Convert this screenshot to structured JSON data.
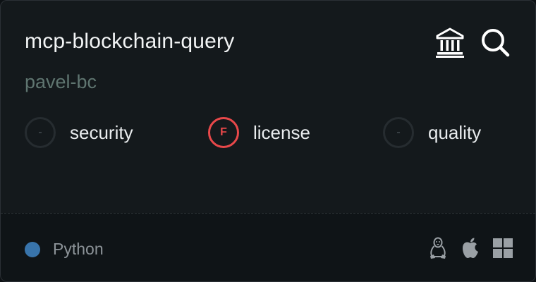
{
  "card": {
    "title": "mcp-blockchain-query",
    "author": "pavel-bc",
    "actions": [
      {
        "icon": "registry-icon"
      },
      {
        "icon": "search-icon"
      }
    ]
  },
  "scores": {
    "security": {
      "grade": "-",
      "label": "security"
    },
    "license": {
      "grade": "F",
      "label": "license"
    },
    "quality": {
      "grade": "-",
      "label": "quality"
    }
  },
  "footer": {
    "language": "Python",
    "language_color": "#3874ab",
    "platforms": [
      "linux-icon",
      "apple-icon",
      "windows-icon"
    ]
  },
  "colors": {
    "fail": "#e8484a",
    "background": "#14191c"
  }
}
